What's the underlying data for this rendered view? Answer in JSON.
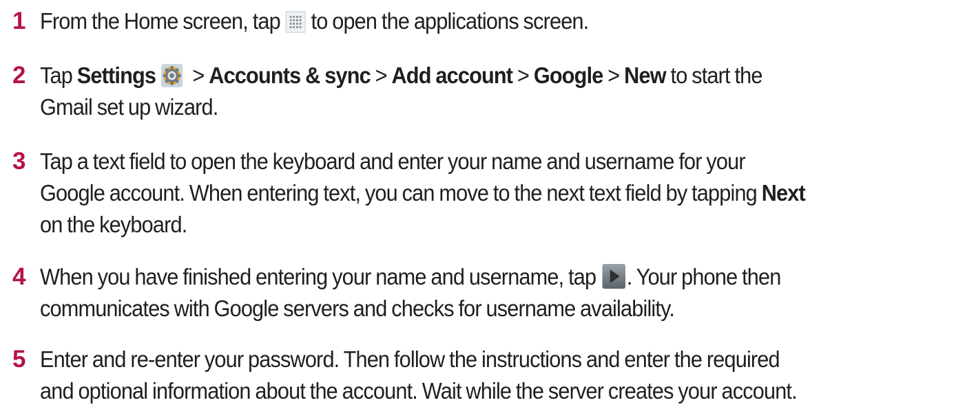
{
  "steps": [
    {
      "number": "1",
      "t1": "From the Home screen, tap",
      "t2": "to open the applications screen."
    },
    {
      "number": "2",
      "t1": "Tap",
      "b1": "Settings",
      "sep": ">",
      "b2": "Accounts & sync",
      "b3": "Add account",
      "b4": "Google",
      "b5": "New",
      "t2": "to start the",
      "t3": "Gmail set up wizard."
    },
    {
      "number": "3",
      "t1": "Tap a text field to open the keyboard and enter your name and username for your",
      "t2": "Google account. When entering text, you can move to the next text field by tapping",
      "b1": "Next",
      "t3": "on the keyboard."
    },
    {
      "number": "4",
      "t1": "When you have finished entering your name and username, tap",
      "t2": ". Your phone then",
      "t3": "communicates with Google servers and checks for username availability."
    },
    {
      "number": "5",
      "t1": "Enter and re-enter your password. Then follow the instructions and enter the required",
      "t2": "and optional information about the account. Wait while the server creates your account."
    }
  ],
  "icons": {
    "apps": "apps-grid-icon",
    "settings": "settings-gear-icon",
    "next": "next-arrow-icon"
  },
  "colors": {
    "step_number": "#b5124b",
    "text": "#1f1f1f"
  }
}
